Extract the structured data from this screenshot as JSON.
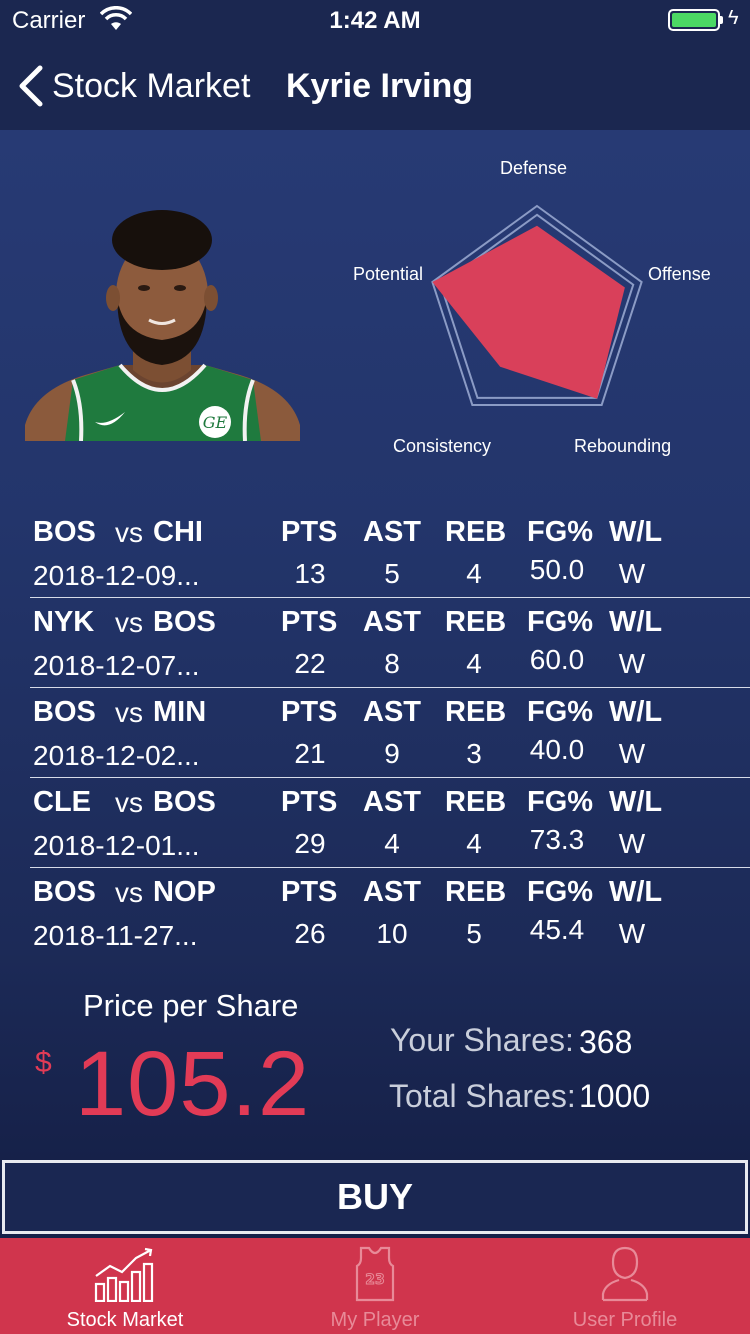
{
  "status_bar": {
    "carrier": "Carrier",
    "time": "1:42 AM"
  },
  "nav": {
    "back_label": "Stock Market",
    "title": "Kyrie Irving"
  },
  "player": {
    "name": "Kyrie Irving",
    "jersey_logo": "GE",
    "radar": {
      "labels": [
        "Defense",
        "Offense",
        "Rebounding",
        "Consistency",
        "Potential"
      ],
      "values": [
        0.82,
        0.84,
        0.93,
        0.57,
        1.0
      ],
      "fill_color": "#d9405a",
      "grid_color": "#8b9bc5"
    }
  },
  "games": {
    "headers": {
      "pts": "PTS",
      "ast": "AST",
      "reb": "REB",
      "fg": "FG%",
      "wl": "W/L"
    },
    "vs_label": "vs",
    "rows": [
      {
        "home": "BOS",
        "away": "CHI",
        "date": "2018-12-09...",
        "pts": "13",
        "ast": "5",
        "reb": "4",
        "fg": "50.0",
        "wl": "W"
      },
      {
        "home": "NYK",
        "away": "BOS",
        "date": "2018-12-07...",
        "pts": "22",
        "ast": "8",
        "reb": "4",
        "fg": "60.0",
        "wl": "W"
      },
      {
        "home": "BOS",
        "away": "MIN",
        "date": "2018-12-02...",
        "pts": "21",
        "ast": "9",
        "reb": "3",
        "fg": "40.0",
        "wl": "W"
      },
      {
        "home": "CLE",
        "away": "BOS",
        "date": "2018-12-01...",
        "pts": "29",
        "ast": "4",
        "reb": "4",
        "fg": "73.3",
        "wl": "W"
      },
      {
        "home": "BOS",
        "away": "NOP",
        "date": "2018-11-27...",
        "pts": "26",
        "ast": "10",
        "reb": "5",
        "fg": "45.4",
        "wl": "W"
      }
    ]
  },
  "price": {
    "label": "Price per Share",
    "currency": "$",
    "value": "105.2",
    "your_shares_label": "Your Shares:",
    "your_shares": "368",
    "total_shares_label": "Total Shares:",
    "total_shares": "1000"
  },
  "buy_label": "BUY",
  "tabs": [
    {
      "label": "Stock Market",
      "icon": "chart-icon",
      "active": true
    },
    {
      "label": "My Player",
      "icon": "jersey-icon",
      "active": false,
      "badge": "23"
    },
    {
      "label": "User Profile",
      "icon": "user-icon",
      "active": false
    }
  ],
  "colors": {
    "accent": "#e23b56",
    "tab_bar": "#d0354d",
    "nav": "#1b2750"
  }
}
